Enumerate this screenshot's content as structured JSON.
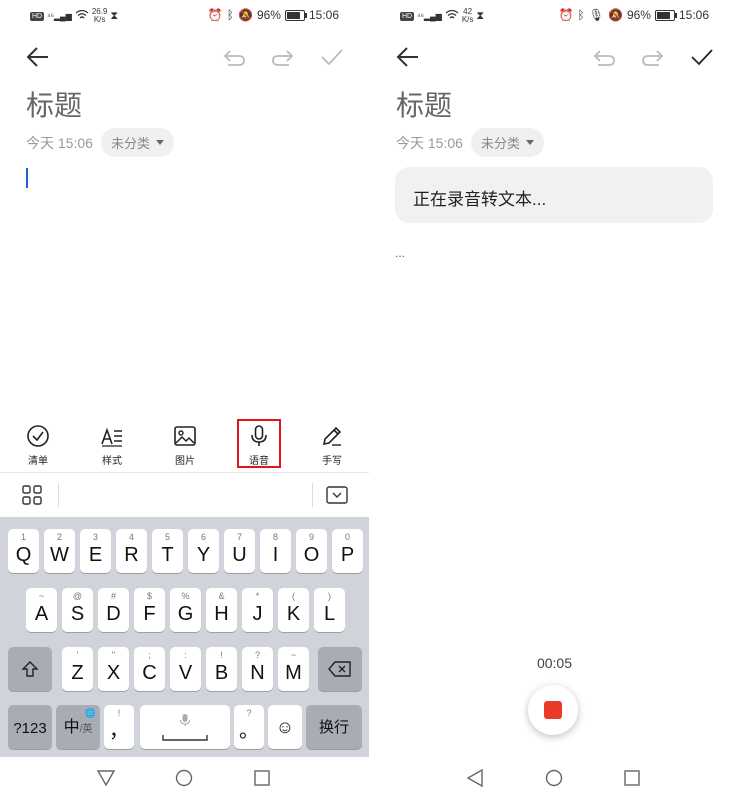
{
  "left": {
    "status": {
      "net_speed": "26.9",
      "net_unit": "K/s",
      "battery": "96%",
      "time": "15:06"
    },
    "note": {
      "title": "标题",
      "date": "今天 15:06",
      "category": "未分类"
    },
    "toolbar": [
      {
        "label": "清单",
        "icon": "checklist-icon"
      },
      {
        "label": "样式",
        "icon": "text-style-icon"
      },
      {
        "label": "图片",
        "icon": "image-icon"
      },
      {
        "label": "语音",
        "icon": "microphone-icon"
      },
      {
        "label": "手写",
        "icon": "pen-icon"
      }
    ],
    "keyboard": {
      "row1": [
        {
          "k": "Q",
          "s": "1"
        },
        {
          "k": "W",
          "s": "2"
        },
        {
          "k": "E",
          "s": "3"
        },
        {
          "k": "R",
          "s": "4"
        },
        {
          "k": "T",
          "s": "5"
        },
        {
          "k": "Y",
          "s": "6"
        },
        {
          "k": "U",
          "s": "7"
        },
        {
          "k": "I",
          "s": "8"
        },
        {
          "k": "O",
          "s": "9"
        },
        {
          "k": "P",
          "s": "0"
        }
      ],
      "row2": [
        {
          "k": "A",
          "s": "~"
        },
        {
          "k": "S",
          "s": "@"
        },
        {
          "k": "D",
          "s": "#"
        },
        {
          "k": "F",
          "s": "$"
        },
        {
          "k": "G",
          "s": "%"
        },
        {
          "k": "H",
          "s": "&"
        },
        {
          "k": "J",
          "s": "*"
        },
        {
          "k": "K",
          "s": "("
        },
        {
          "k": "L",
          "s": ")"
        }
      ],
      "row3": [
        {
          "k": "Z",
          "s": "'"
        },
        {
          "k": "X",
          "s": "\""
        },
        {
          "k": "C",
          "s": ";"
        },
        {
          "k": "V",
          "s": ":"
        },
        {
          "k": "B",
          "s": "!"
        },
        {
          "k": "N",
          "s": "?"
        },
        {
          "k": "M",
          "s": "~"
        }
      ],
      "num_label": "?123",
      "lang_label": "中",
      "lang_sub": "/英",
      "comma": "，",
      "comma_sub": "!",
      "period": "。",
      "period_sub": "?",
      "enter_label": "换行"
    }
  },
  "right": {
    "status": {
      "net_speed": "42",
      "net_unit": "K/s",
      "battery": "96%",
      "time": "15:06"
    },
    "note": {
      "title": "标题",
      "date": "今天 15:06",
      "category": "未分类"
    },
    "transcribing": "正在录音转文本...",
    "placeholder": "...",
    "timer": "00:05"
  }
}
